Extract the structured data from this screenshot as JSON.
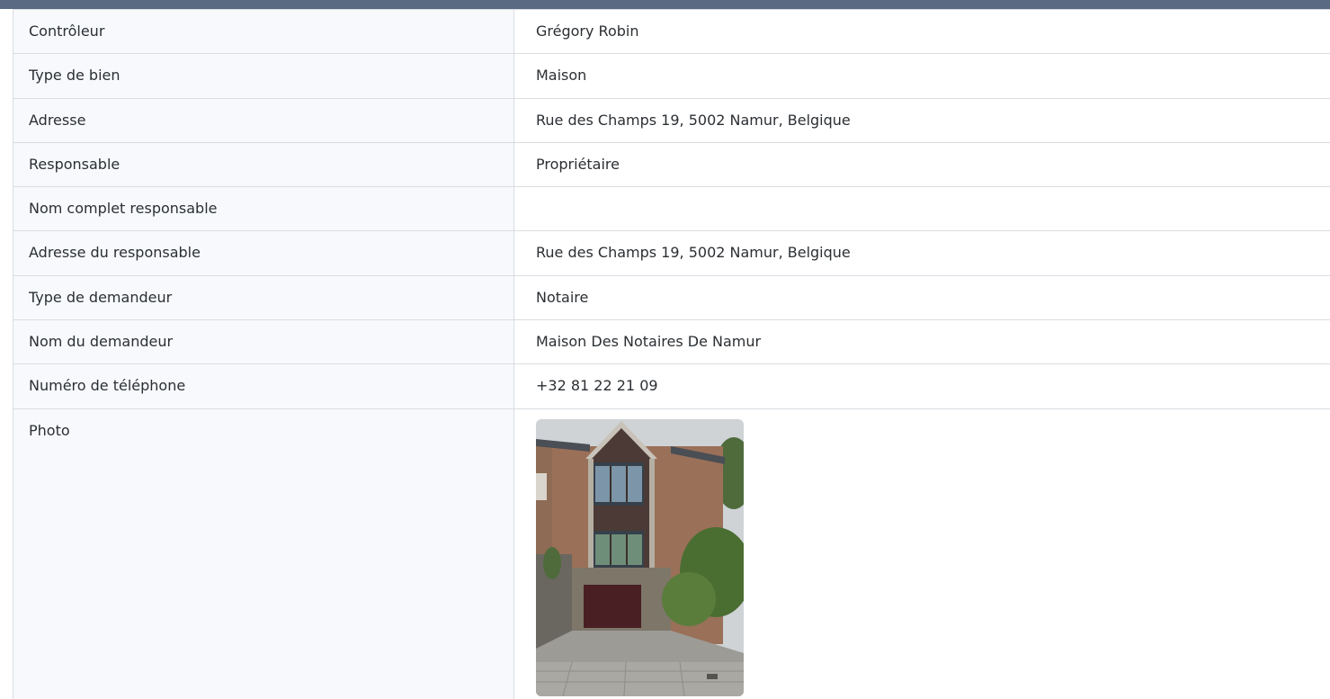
{
  "rows": [
    {
      "label": "Contrôleur",
      "value": "Grégory Robin"
    },
    {
      "label": "Type de bien",
      "value": "Maison"
    },
    {
      "label": "Adresse",
      "value": "Rue des Champs 19, 5002 Namur, Belgique"
    },
    {
      "label": "Responsable",
      "value": "Propriétaire"
    },
    {
      "label": "Nom complet responsable",
      "value": ""
    },
    {
      "label": "Adresse du responsable",
      "value": "Rue des Champs 19, 5002 Namur, Belgique"
    },
    {
      "label": "Type de demandeur",
      "value": "Notaire"
    },
    {
      "label": "Nom du demandeur",
      "value": "Maison Des Notaires De Namur"
    },
    {
      "label": "Numéro de téléphone",
      "value": "+32 81 22 21 09"
    }
  ],
  "photo": {
    "label": "Photo",
    "icon": "house-photo"
  },
  "colors": {
    "header_bar": "#5a6a82",
    "label_bg": "#f7f9fc",
    "border": "#d9dde2"
  }
}
